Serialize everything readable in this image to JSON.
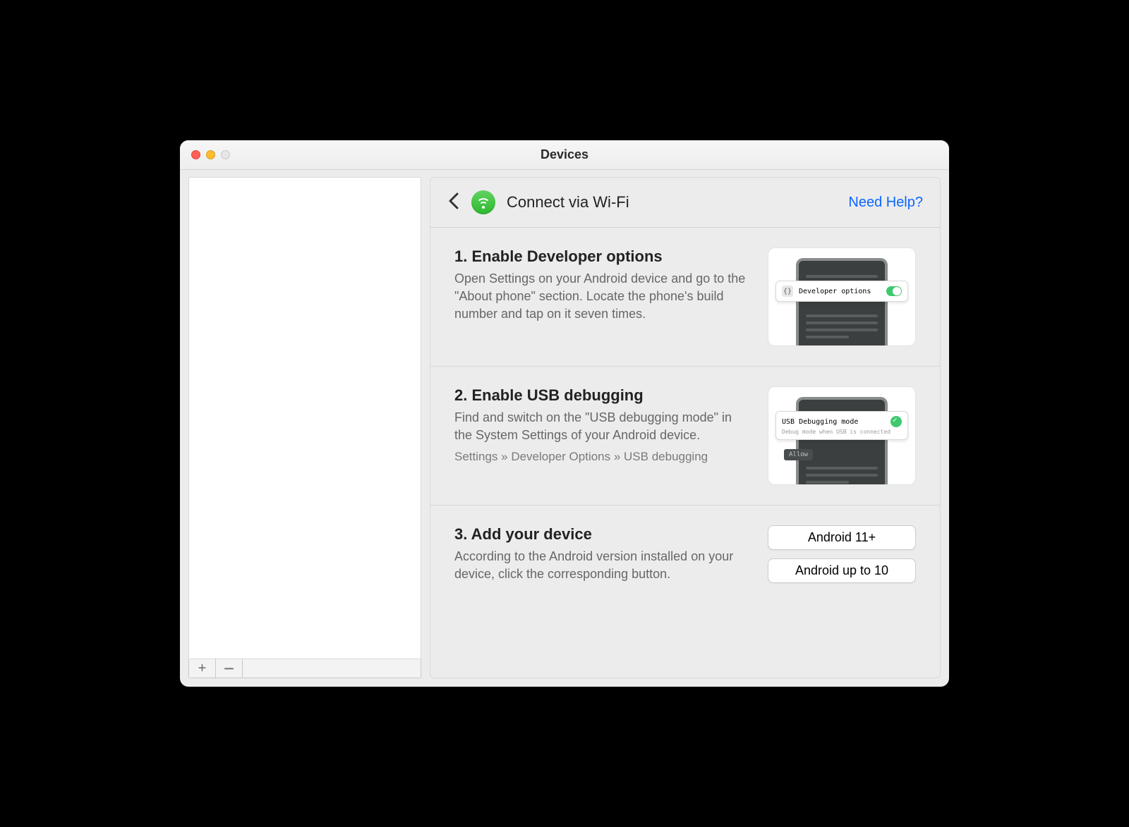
{
  "window": {
    "title": "Devices"
  },
  "header": {
    "title": "Connect via Wi-Fi",
    "help": "Need Help?"
  },
  "steps": [
    {
      "heading": "1. Enable Developer options",
      "body": "Open Settings on your Android device and go to the \"About phone\" section. Locate the phone's build number and tap on it seven times.",
      "thumb": {
        "label": "Developer options"
      }
    },
    {
      "heading": "2. Enable USB debugging",
      "body": "Find and switch on the \"USB debugging mode\" in the System Settings of your Android device.",
      "sub": "Settings » Developer Options » USB debugging",
      "thumb": {
        "label": "USB Debugging mode",
        "sub": "Debug mode when USB is connected",
        "allow": "Allow"
      }
    },
    {
      "heading": "3. Add your device",
      "body": "According to the Android version installed on your device, click the corresponding button.",
      "buttons": [
        "Android 11+",
        "Android up to 10"
      ]
    }
  ],
  "sidebar": {
    "add": "+",
    "remove": "−"
  }
}
